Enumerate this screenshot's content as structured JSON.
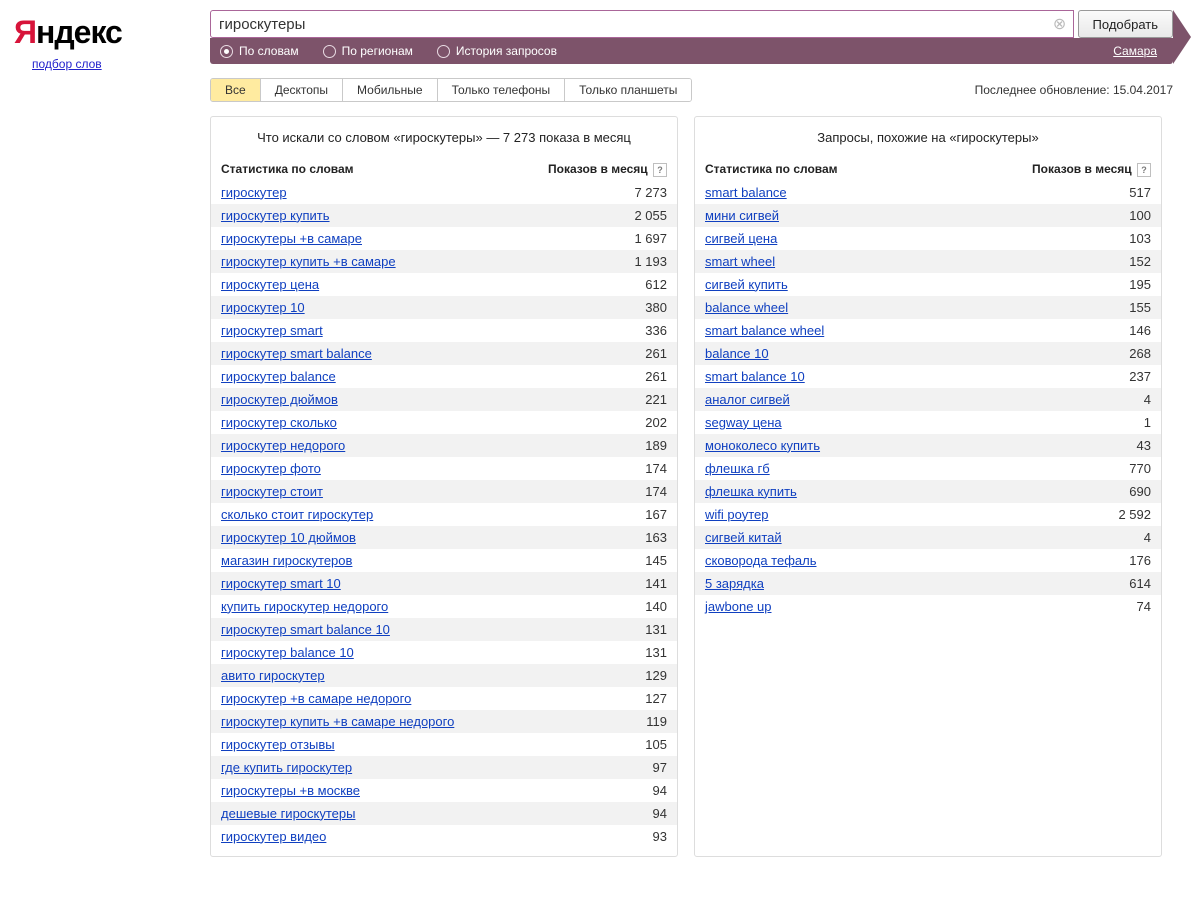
{
  "logo": {
    "ya": "Я",
    "ndex": "ндекс",
    "subtitle": "подбор слов"
  },
  "search": {
    "value": "гироскутеры",
    "submit_label": "Подобрать",
    "clear_glyph": "⊗"
  },
  "filters": {
    "by_words": "По словам",
    "by_regions": "По регионам",
    "history": "История запросов",
    "region": "Самара"
  },
  "device_tabs": {
    "all": "Все",
    "desktops": "Десктопы",
    "mobile": "Мобильные",
    "phones": "Только телефоны",
    "tablets": "Только планшеты"
  },
  "last_update": "Последнее обновление: 15.04.2017",
  "left_panel": {
    "title": "Что искали со словом «гироскутеры» — 7 273 показа в месяц",
    "col_word": "Статистика по словам",
    "col_count": "Показов в месяц",
    "help": "?",
    "rows": [
      {
        "word": "гироскутер",
        "count": "7 273"
      },
      {
        "word": "гироскутер купить",
        "count": "2 055"
      },
      {
        "word": "гироскутеры +в самаре",
        "count": "1 697"
      },
      {
        "word": "гироскутер купить +в самаре",
        "count": "1 193"
      },
      {
        "word": "гироскутер цена",
        "count": "612"
      },
      {
        "word": "гироскутер 10",
        "count": "380"
      },
      {
        "word": "гироскутер smart",
        "count": "336"
      },
      {
        "word": "гироскутер smart balance",
        "count": "261"
      },
      {
        "word": "гироскутер balance",
        "count": "261"
      },
      {
        "word": "гироскутер дюймов",
        "count": "221"
      },
      {
        "word": "гироскутер сколько",
        "count": "202"
      },
      {
        "word": "гироскутер недорого",
        "count": "189"
      },
      {
        "word": "гироскутер фото",
        "count": "174"
      },
      {
        "word": "гироскутер стоит",
        "count": "174"
      },
      {
        "word": "сколько стоит гироскутер",
        "count": "167"
      },
      {
        "word": "гироскутер 10 дюймов",
        "count": "163"
      },
      {
        "word": "магазин гироскутеров",
        "count": "145"
      },
      {
        "word": "гироскутер smart 10",
        "count": "141"
      },
      {
        "word": "купить гироскутер недорого",
        "count": "140"
      },
      {
        "word": "гироскутер smart balance 10",
        "count": "131"
      },
      {
        "word": "гироскутер balance 10",
        "count": "131"
      },
      {
        "word": "авито гироскутер",
        "count": "129"
      },
      {
        "word": "гироскутер +в самаре недорого",
        "count": "127"
      },
      {
        "word": "гироскутер купить +в самаре недорого",
        "count": "119"
      },
      {
        "word": "гироскутер отзывы",
        "count": "105"
      },
      {
        "word": "где купить гироскутер",
        "count": "97"
      },
      {
        "word": "гироскутеры +в москве",
        "count": "94"
      },
      {
        "word": "дешевые гироскутеры",
        "count": "94"
      },
      {
        "word": "гироскутер видео",
        "count": "93"
      }
    ]
  },
  "right_panel": {
    "title": "Запросы, похожие на «гироскутеры»",
    "col_word": "Статистика по словам",
    "col_count": "Показов в месяц",
    "help": "?",
    "rows": [
      {
        "word": "smart balance",
        "count": "517"
      },
      {
        "word": "мини сигвей",
        "count": "100"
      },
      {
        "word": "сигвей цена",
        "count": "103"
      },
      {
        "word": "smart wheel",
        "count": "152"
      },
      {
        "word": "сигвей купить",
        "count": "195"
      },
      {
        "word": "balance wheel",
        "count": "155"
      },
      {
        "word": "smart balance wheel",
        "count": "146"
      },
      {
        "word": "balance 10",
        "count": "268"
      },
      {
        "word": "smart balance 10",
        "count": "237"
      },
      {
        "word": "аналог сигвей",
        "count": "4"
      },
      {
        "word": "segway цена",
        "count": "1"
      },
      {
        "word": "моноколесо купить",
        "count": "43"
      },
      {
        "word": "флешка гб",
        "count": "770"
      },
      {
        "word": "флешка купить",
        "count": "690"
      },
      {
        "word": "wifi роутер",
        "count": "2 592"
      },
      {
        "word": "сигвей китай",
        "count": "4"
      },
      {
        "word": "сковорода тефаль",
        "count": "176"
      },
      {
        "word": "5 зарядка",
        "count": "614"
      },
      {
        "word": "jawbone up",
        "count": "74"
      }
    ]
  }
}
